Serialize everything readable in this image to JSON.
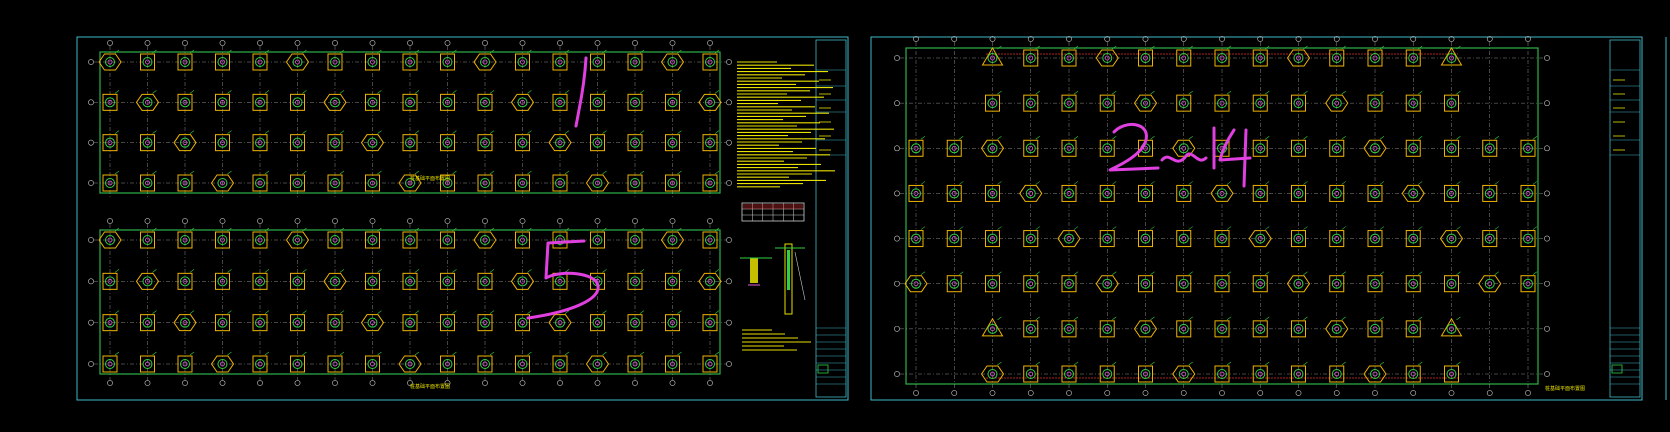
{
  "canvas": {
    "background": "#000000",
    "sheet_border_color": "#3fb8c8",
    "frame_color": "#2db34a",
    "axis_color": "#c8c8c8",
    "pile_outline_color": "#f0b400",
    "pile_ring_color": "#30d040",
    "pile_core_color": "#e060e0",
    "note_text_color": "#e8e000",
    "dimension_color": "#e03030",
    "handwriting_color": "#e040e0"
  },
  "sheet1": {
    "plan_top": {
      "columns": 17,
      "rows": 4,
      "title": "桩基础平面布置图"
    },
    "plan_bottom": {
      "columns": 17,
      "rows": 4,
      "title": "桩基础平面布置图"
    },
    "handwritten_marks": [
      "1",
      "5"
    ],
    "notes_lines": 40,
    "legend_table": {
      "rows": 3,
      "cols": 6
    }
  },
  "sheet2": {
    "plan": {
      "columns": 17,
      "rows": 8,
      "title": "桩基础平面布置图"
    },
    "handwritten_mark": "2-14"
  },
  "sheet3": {
    "partial": true
  }
}
